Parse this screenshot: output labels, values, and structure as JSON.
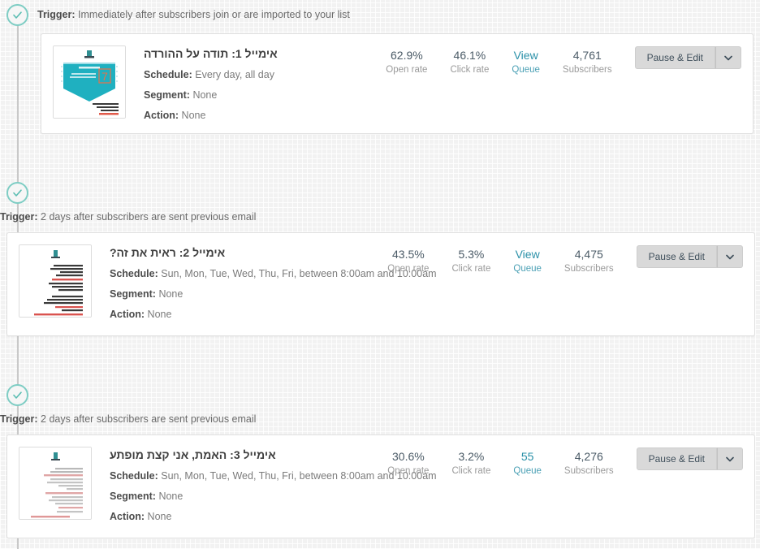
{
  "rail": {
    "color": "#c9c9c9"
  },
  "theme": {
    "accent_teal": "#7ecdc4",
    "link_blue": "#2a90a8",
    "button_gray": "#d9d9d9",
    "page_bg": "#f2f2f2"
  },
  "labels": {
    "trigger_prefix": "Trigger:",
    "schedule_key": "Schedule:",
    "segment_key": "Segment:",
    "action_key": "Action:",
    "open_rate_caption": "Open rate",
    "click_rate_caption": "Click rate",
    "queue_caption": "Queue",
    "subscribers_caption": "Subscribers",
    "pause_edit": "Pause & Edit"
  },
  "steps": [
    {
      "check_icon": "check-circle-icon",
      "trigger": "Immediately after subscribers join or are imported to your list",
      "email": {
        "thumbnail": "email-thumbnail-teal-coupon",
        "title": "אימייל 1: תודה על ההורדה",
        "schedule": "Every day, all day",
        "segment": "None",
        "action": "None"
      },
      "stats": {
        "open_rate": "62.9%",
        "click_rate": "46.1%",
        "queue": "View",
        "subscribers": "4,761"
      },
      "buttons": {
        "primary": "Pause & Edit",
        "caret": "chevron-down-icon"
      }
    },
    {
      "check_icon": "check-circle-icon",
      "trigger": "2 days after subscribers are sent previous email",
      "email": {
        "thumbnail": "email-thumbnail-text-dark",
        "title": "אימייל 2: ראית את זה?",
        "schedule": "Sun, Mon, Tue, Wed, Thu, Fri, between 8:00am and 10:00am",
        "segment": "None",
        "action": "None"
      },
      "stats": {
        "open_rate": "43.5%",
        "click_rate": "5.3%",
        "queue": "View",
        "subscribers": "4,475"
      },
      "buttons": {
        "primary": "Pause & Edit",
        "caret": "chevron-down-icon"
      }
    },
    {
      "check_icon": "check-circle-icon",
      "trigger": "2 days after subscribers are sent previous email",
      "email": {
        "thumbnail": "email-thumbnail-text-light",
        "title": "אימייל 3: האמת, אני קצת מופתע",
        "schedule": "Sun, Mon, Tue, Wed, Thu, Fri, between 8:00am and 10:00am",
        "segment": "None",
        "action": "None"
      },
      "stats": {
        "open_rate": "30.6%",
        "click_rate": "3.2%",
        "queue": "55",
        "subscribers": "4,276"
      },
      "buttons": {
        "primary": "Pause & Edit",
        "caret": "chevron-down-icon"
      }
    }
  ]
}
